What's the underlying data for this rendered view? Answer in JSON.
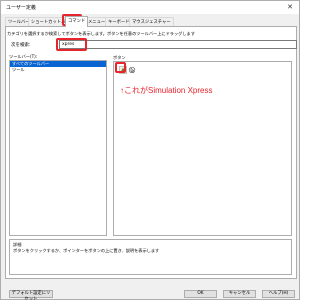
{
  "window": {
    "title": "ユーザー定義",
    "close_glyph": "✕"
  },
  "tabs": [
    {
      "label": "ツールバー"
    },
    {
      "label": "ショートカットバー"
    },
    {
      "label": "コマンド"
    },
    {
      "label": "メニュー"
    },
    {
      "label": "キーボード"
    },
    {
      "label": "マウスジェスチャー"
    }
  ],
  "description": "カテゴリを選択するか検索してボタンを表示します。ボタンを任意のツールバー上にドラッグします",
  "search": {
    "label": "次を検索:",
    "value": "xpres"
  },
  "toolbar_list": {
    "label": "ツールバー(T):",
    "items": [
      "すべてのツールバー",
      "ツール"
    ],
    "selected_index": 0
  },
  "buttons_area": {
    "label": "ボタン",
    "icons": [
      "simulation-xpress-icon",
      "cursor-icon"
    ]
  },
  "annotation": {
    "text": "↑これがSimulation Xpress"
  },
  "detail": {
    "label": "詳細",
    "text": "ボタンをクリックするか、ポインターをボタンの上に置き、説明を表示します"
  },
  "footer": {
    "reset_label": "デフォルト設定にリセット",
    "ok_label": "OK",
    "cancel_label": "キャンセル",
    "help_label": "ヘルプ(H)"
  },
  "colors": {
    "highlight": "#e8242c",
    "selection": "#0a64d2"
  }
}
